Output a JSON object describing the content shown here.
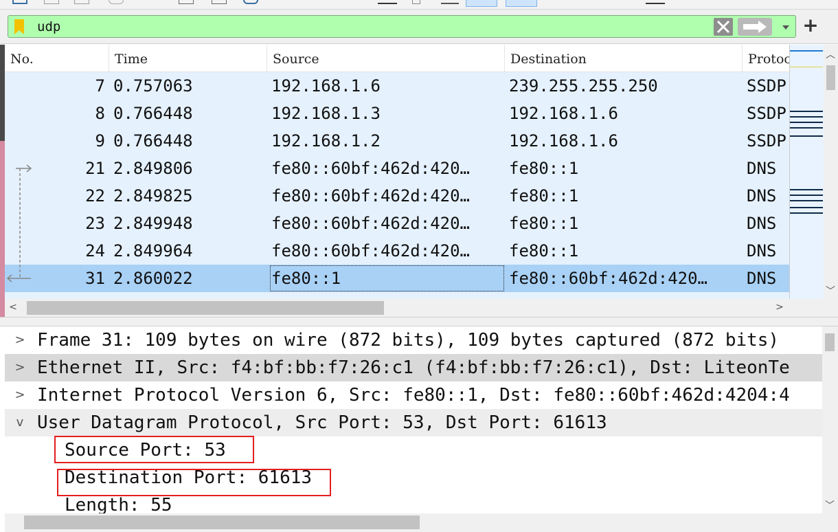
{
  "filter": {
    "value": "udp",
    "add_button": "+"
  },
  "packet_list": {
    "columns": [
      "No.",
      "Time",
      "Source",
      "Destination",
      "Protocol"
    ],
    "rows": [
      {
        "no": "7",
        "time": "0.757063",
        "source": "192.168.1.6",
        "destination": "239.255.255.250",
        "protocol": "SSDP"
      },
      {
        "no": "8",
        "time": "0.766448",
        "source": "192.168.1.3",
        "destination": "192.168.1.6",
        "protocol": "SSDP"
      },
      {
        "no": "9",
        "time": "0.766448",
        "source": "192.168.1.2",
        "destination": "192.168.1.6",
        "protocol": "SSDP"
      },
      {
        "no": "21",
        "time": "2.849806",
        "source": "fe80::60bf:462d:420…",
        "destination": "fe80::1",
        "protocol": "DNS"
      },
      {
        "no": "22",
        "time": "2.849825",
        "source": "fe80::60bf:462d:420…",
        "destination": "fe80::1",
        "protocol": "DNS"
      },
      {
        "no": "23",
        "time": "2.849948",
        "source": "fe80::60bf:462d:420…",
        "destination": "fe80::1",
        "protocol": "DNS"
      },
      {
        "no": "24",
        "time": "2.849964",
        "source": "fe80::60bf:462d:420…",
        "destination": "fe80::1",
        "protocol": "DNS"
      },
      {
        "no": "31",
        "time": "2.860022",
        "source": "fe80::1",
        "destination": "fe80::60bf:462d:420…",
        "protocol": "DNS"
      }
    ],
    "selected_row": "31"
  },
  "details": {
    "items": [
      {
        "expander": ">",
        "text": "Frame 31: 109 bytes on wire (872 bits), 109 bytes captured (872 bits)"
      },
      {
        "expander": ">",
        "text": "Ethernet II, Src: f4:bf:bb:f7:26:c1 (f4:bf:bb:f7:26:c1), Dst: LiteonTe"
      },
      {
        "expander": ">",
        "text": "Internet Protocol Version 6, Src: fe80::1, Dst: fe80::60bf:462d:4204:4"
      },
      {
        "expander": "v",
        "text": "User Datagram Protocol, Src Port: 53, Dst Port: 61613"
      }
    ],
    "udp_fields": [
      "Source Port: 53",
      "Destination Port: 61613",
      "Length: 55"
    ]
  },
  "colors": {
    "filter_valid": "#afffaf",
    "row_bg": "#e5f1fd",
    "row_selected": "#a9d1f6",
    "annotation_box": "#e31e1e"
  }
}
